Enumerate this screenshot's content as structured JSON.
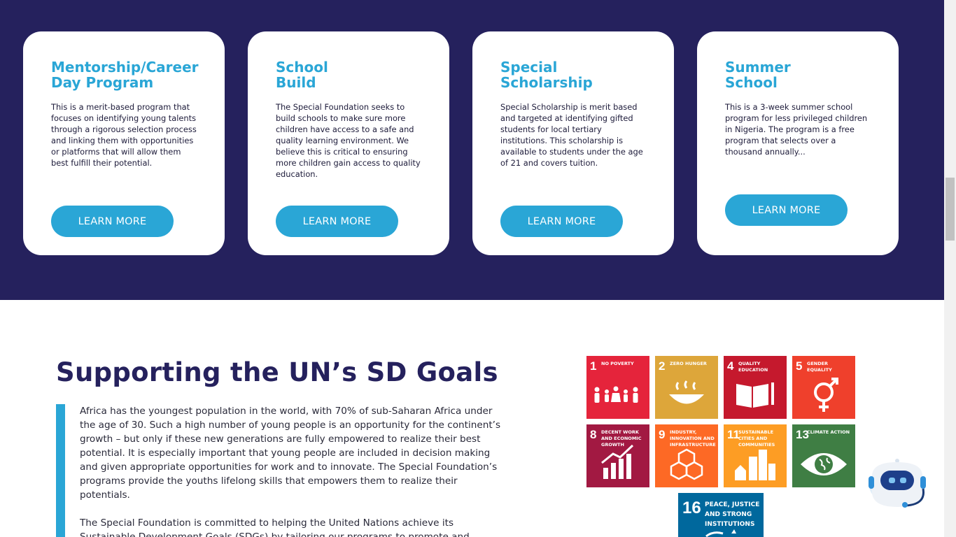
{
  "programs": [
    {
      "title": "Mentorship/Career Day Program",
      "desc": "This is a merit-based program that focuses on identifying young talents through a rigorous selection process and linking them with opportunities or platforms that will allow them best fulfill their potential.",
      "button": "LEARN MORE"
    },
    {
      "title": "School Build",
      "desc": "The Special Foundation seeks to build schools to make sure more children have access to a safe and quality learning environment. We believe this is critical to ensuring more children gain access to quality education.",
      "button": "LEARN MORE"
    },
    {
      "title": "Special Scholarship",
      "desc": "Special Scholarship is merit based and targeted at identifying gifted students for local tertiary institutions. This scholarship is available to students under the age of 21 and covers tuition.",
      "button": "LEARN MORE"
    },
    {
      "title": "Summer School",
      "desc": "This is a 3-week summer school program for less privileged children in Nigeria. The program is a free program that selects over a thousand annually...",
      "button": "LEARN MORE"
    }
  ],
  "sdg": {
    "title": "Supporting the UN’s SD Goals",
    "paragraph1": "Africa has the youngest population in the world, with 70% of sub-Saharan Africa under the age of 30. Such a high number of young people is an opportunity for the continent’s growth – but only if these new generations are fully empowered to realize their best potential. It is especially important that young people are included in decision making and given appropriate opportunities for work and to innovate. The Special Foundation’s programs provide the youths lifelong skills that empowers them to realize their potentials.",
    "paragraph2": "The Special Foundation is committed to helping the United Nations achieve its Sustainable Development Goals (SDGs) by tailoring our programs to promote and",
    "goals": [
      {
        "num": "1",
        "label": "NO POVERTY",
        "color": "#e5243b",
        "icon": "family-icon"
      },
      {
        "num": "2",
        "label": "ZERO HUNGER",
        "color": "#dda63a",
        "icon": "bowl-icon"
      },
      {
        "num": "4",
        "label": "QUALITY EDUCATION",
        "color": "#c5192d",
        "icon": "book-icon"
      },
      {
        "num": "5",
        "label": "GENDER EQUALITY",
        "color": "#ef402c",
        "icon": "gender-icon"
      },
      {
        "num": "8",
        "label": "DECENT WORK AND ECONOMIC GROWTH",
        "color": "#a21942",
        "icon": "growth-chart-icon"
      },
      {
        "num": "9",
        "label": "INDUSTRY, INNOVATION AND INFRASTRUCTURE",
        "color": "#fd6925",
        "icon": "cubes-icon"
      },
      {
        "num": "11",
        "label": "SUSTAINABLE CITIES AND COMMUNITIES",
        "color": "#fd9d24",
        "icon": "city-icon"
      },
      {
        "num": "13",
        "label": "CLIMATE ACTION",
        "color": "#3f7e44",
        "icon": "eye-globe-icon"
      },
      {
        "num": "16",
        "label": "PEACE, JUSTICE AND STRONG INSTITUTIONS",
        "color": "#00689d",
        "icon": "dove-icon"
      }
    ]
  },
  "chatbot": {
    "icon": "chatbot-icon"
  }
}
